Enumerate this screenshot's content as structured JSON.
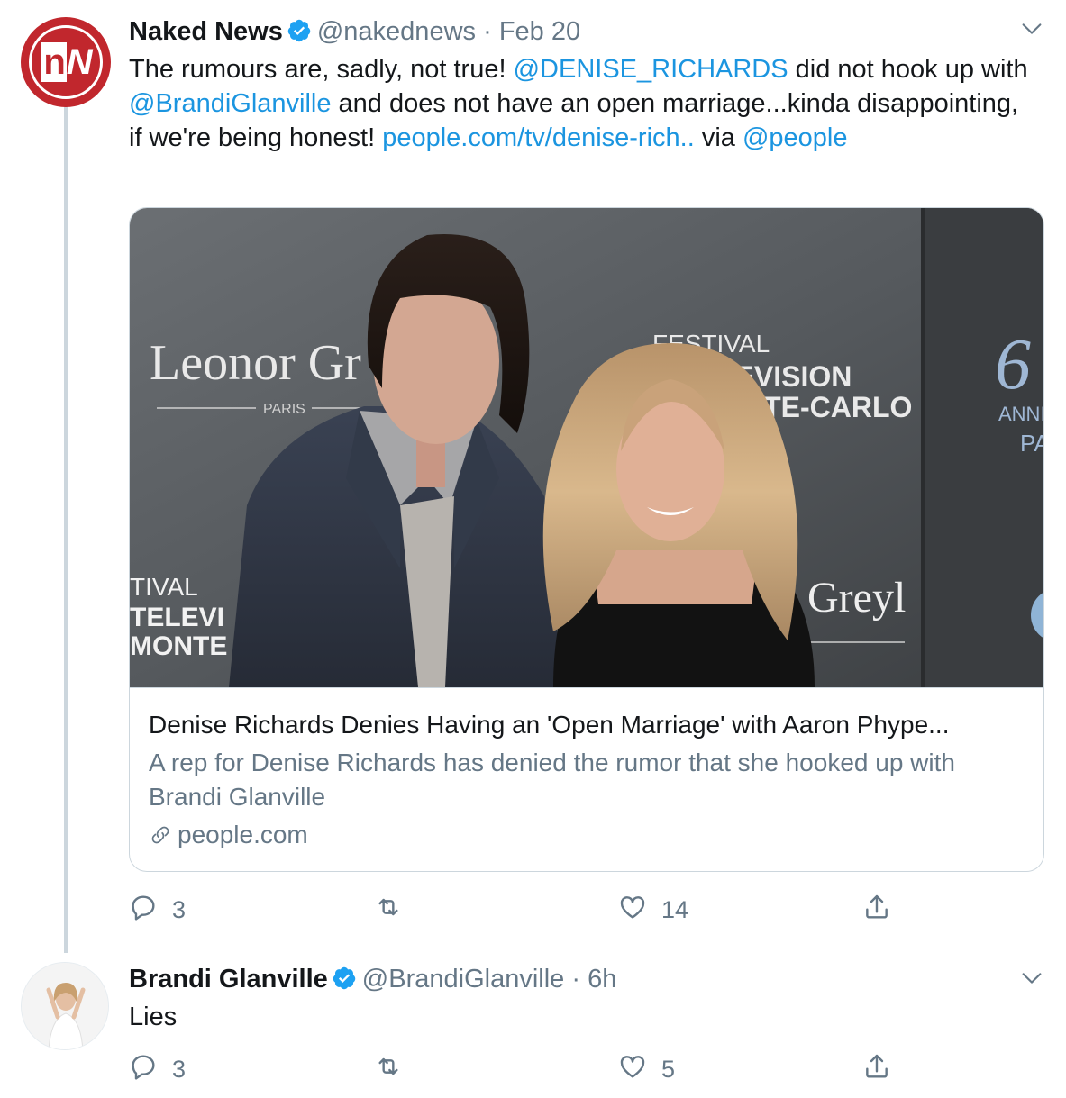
{
  "tweets": [
    {
      "display_name": "Naked News",
      "verified": true,
      "handle": "@nakednews",
      "separator": "·",
      "time": "Feb 20",
      "avatar_icon": "naked-news-logo",
      "text_parts": {
        "p1": "The rumours are, sadly, not true! ",
        "m1": "@DENISE_RICHARDS",
        "p2": " did not hook up with ",
        "m2": "@BrandiGlanville",
        "p3": " and does not have an open marriage...kinda disappointing, if we're being honest! ",
        "url": "people.com/tv/denise-rich..",
        "p4": " via ",
        "m3": "@people"
      },
      "card": {
        "image_desc": "photo",
        "backdrop_text": {
          "brand": "Leonor Gr",
          "brand_sub": "PARIS",
          "fest1": "FESTIVAL",
          "fest2": "LEVISION",
          "fest3": "NTE-CARLO",
          "left1": "TIVAL",
          "left2": "TELEVI",
          "left3": "MONTE",
          "right_brand": "Greyl",
          "far_right1": "ANNIV",
          "far_right2": "PA"
        },
        "title": "Denise Richards Denies Having an 'Open Marriage' with Aaron Phype...",
        "description": "A rep for Denise Richards has denied the rumor that she hooked up with Brandi Glanville",
        "domain": "people.com",
        "domain_icon": "link-icon"
      },
      "actions": {
        "replies": "3",
        "retweets": "",
        "likes": "14"
      }
    },
    {
      "display_name": "Brandi Glanville",
      "verified": true,
      "handle": "@BrandiGlanville",
      "separator": "·",
      "time": "6h",
      "avatar_icon": "profile-photo",
      "text": "Lies",
      "actions": {
        "replies": "3",
        "retweets": "",
        "likes": "5"
      }
    }
  ],
  "colors": {
    "link": "#1b95e0",
    "secondary_text": "#657786",
    "verified_badge": "#1da1f2",
    "brand_red": "#c1272d",
    "border": "#ccd6dd"
  }
}
